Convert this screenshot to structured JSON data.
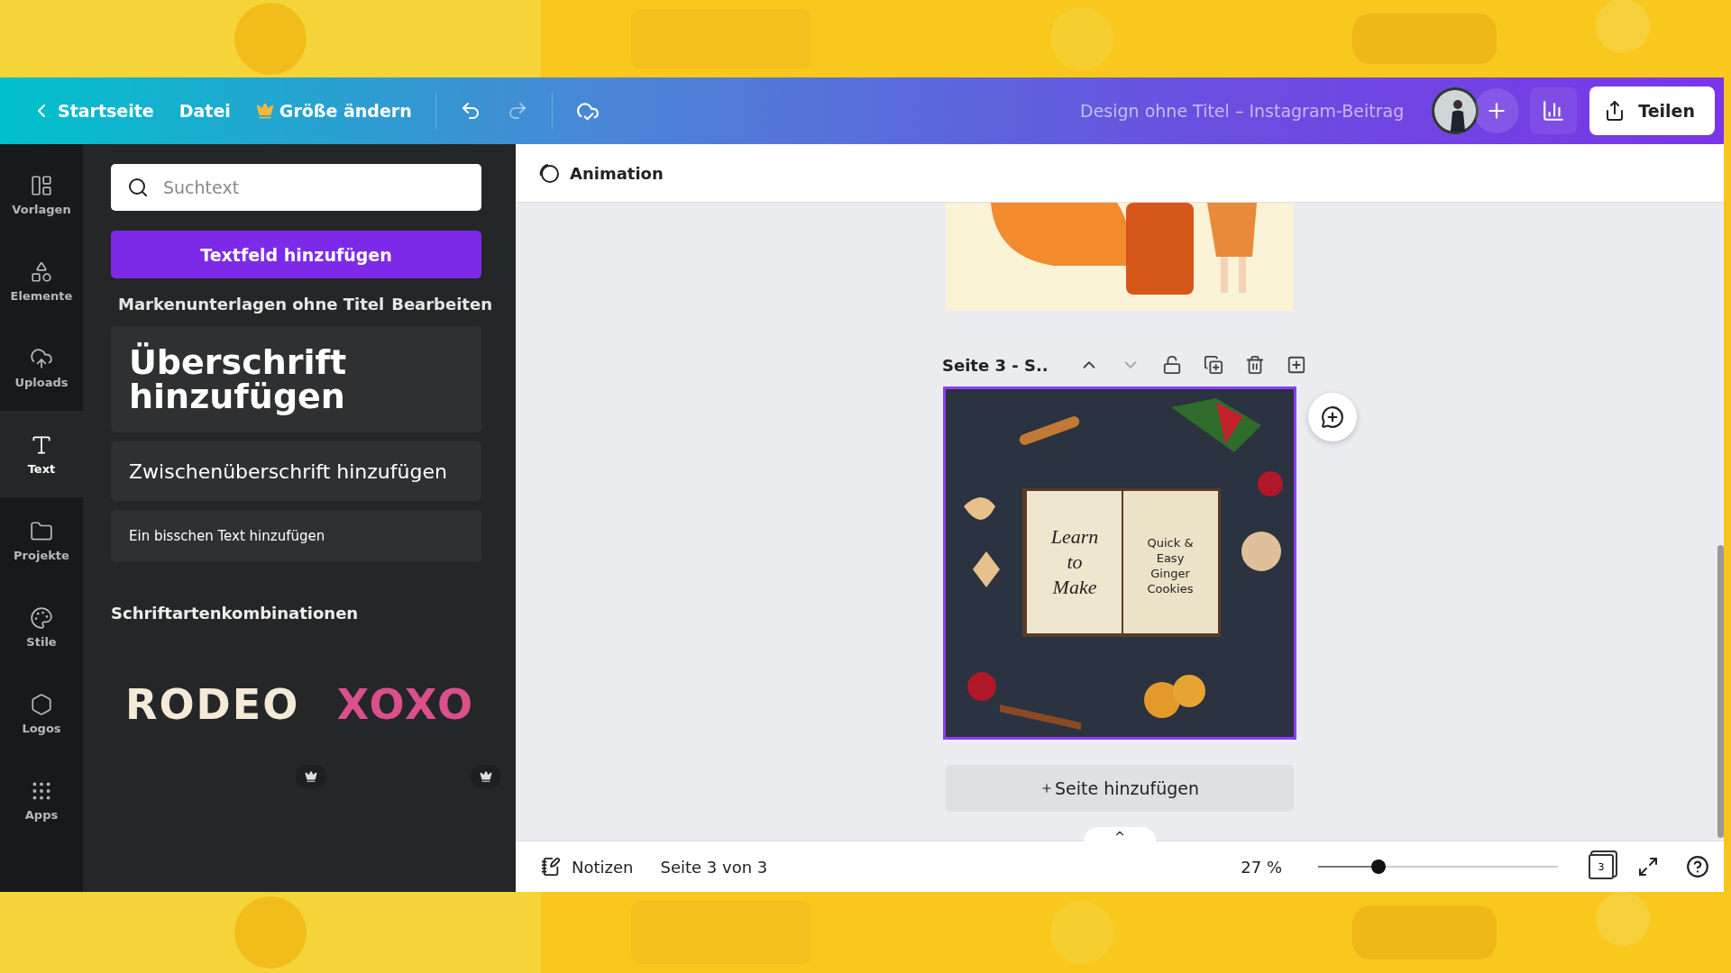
{
  "topbar": {
    "back": "Startseite",
    "menu": [
      {
        "label": "Datei",
        "kind": "plain"
      },
      {
        "label": "Größe ändern",
        "kind": "crown"
      }
    ],
    "title": "Design ohne Titel – Instagram-Beitrag",
    "share": "Teilen"
  },
  "rail": [
    {
      "label": "Vorlagen",
      "selected": false
    },
    {
      "label": "Elemente",
      "selected": false
    },
    {
      "label": "Uploads",
      "selected": false
    },
    {
      "label": "Text",
      "selected": true
    },
    {
      "label": "Projekte",
      "selected": false
    },
    {
      "label": "Stile",
      "selected": false
    },
    {
      "label": "Logos",
      "selected": false
    },
    {
      "label": "Apps",
      "selected": false
    }
  ],
  "panel": {
    "search": {
      "placeholder": "Suchtext"
    },
    "add_button": "Textfeld hinzufügen",
    "brand": "Markenunterlagen ohne Titel",
    "brand_edit": "Bearbeiten",
    "presets": [
      {
        "label": "Überschrift hinzufügen",
        "kind": "heading"
      },
      {
        "label": "Zwischenüberschrift hinzufügen",
        "kind": "subheading"
      },
      {
        "label": "Ein bisschen Text hinzufügen",
        "kind": "body"
      }
    ],
    "combos_title": "Schriftartenkombinationen",
    "combos": [
      {
        "label": "RODEO",
        "kind": "rodeo"
      },
      {
        "label": "XOXO",
        "kind": "xoxo"
      }
    ]
  },
  "toolbar": {
    "animation": "Animation"
  },
  "canvas": {
    "page_label": "Seite 3 - S..",
    "design_left": "Learn to Make",
    "design_right": "Quick & Easy Ginger Cookies",
    "add_page": "Seite hinzufügen"
  },
  "bottom": {
    "notes": "Notizen",
    "pages": "Seite 3 von 3",
    "zoom": "27 %",
    "zoom_slider": {
      "level": 0.25
    },
    "page_count": "3"
  }
}
